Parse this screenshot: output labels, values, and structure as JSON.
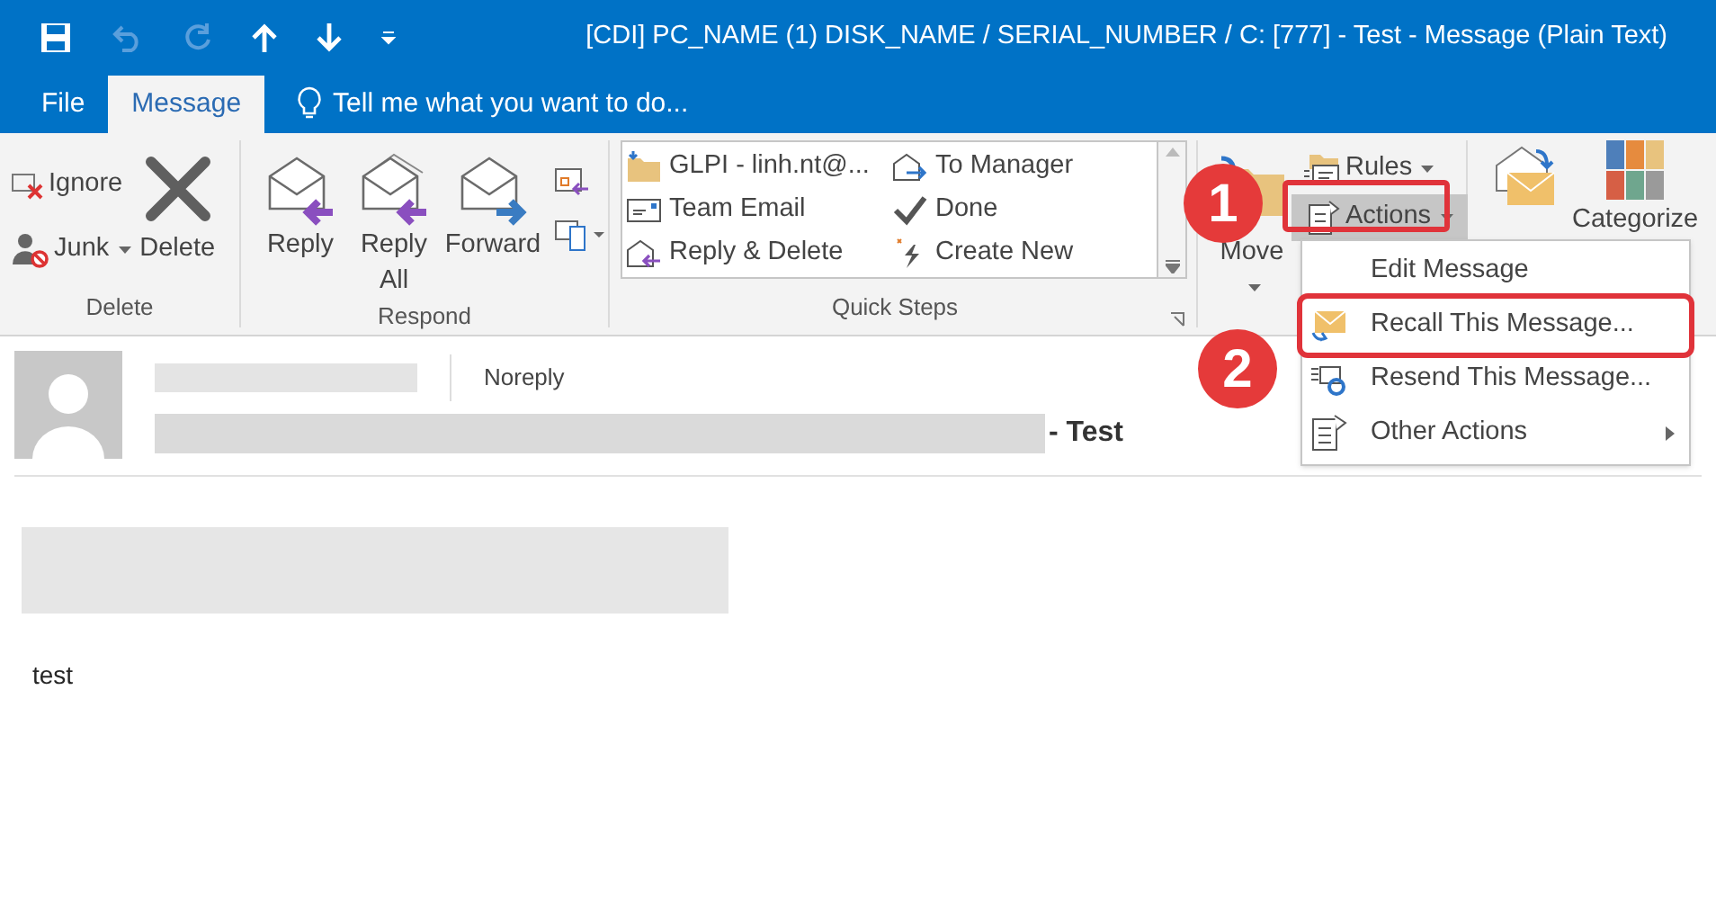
{
  "window": {
    "title": "[CDI] PC_NAME (1) DISK_NAME / SERIAL_NUMBER / C: [777] - Test - Message (Plain Text)"
  },
  "tabs": [
    {
      "label": "File",
      "selected": false
    },
    {
      "label": "Message",
      "selected": true
    }
  ],
  "tell_me": {
    "placeholder": "Tell me what you want to do..."
  },
  "delete_group": {
    "label": "Delete",
    "ignore": "Ignore",
    "junk": "Junk",
    "delete": "Delete"
  },
  "respond_group": {
    "label": "Respond",
    "reply": "Reply",
    "reply_all": [
      "Reply",
      "All"
    ],
    "forward": "Forward"
  },
  "quick_steps": {
    "label": "Quick Steps",
    "items": [
      {
        "kind": "folder",
        "label": "GLPI - linh.nt@..."
      },
      {
        "kind": "forward",
        "label": "To Manager"
      },
      {
        "kind": "email",
        "label": "Team Email"
      },
      {
        "kind": "check",
        "label": "Done"
      },
      {
        "kind": "reply",
        "label": "Reply & Delete"
      },
      {
        "kind": "new",
        "label": "Create New"
      }
    ]
  },
  "move_group": {
    "move": "Move",
    "rules": "Rules",
    "actions": {
      "label": "Actions",
      "expanded": true,
      "annotated": true
    }
  },
  "tags_group": {
    "categorize": "Categorize"
  },
  "message": {
    "from": "Noreply",
    "subject_suffix": "- Test",
    "body": "test"
  },
  "actions_menu": [
    {
      "kind": "edit",
      "label": "Edit Message",
      "annotated": false,
      "submenu": false
    },
    {
      "kind": "recall",
      "label": "Recall This Message...",
      "annotated": true,
      "submenu": false
    },
    {
      "kind": "resend",
      "label": "Resend This Message...",
      "annotated": false,
      "submenu": false
    },
    {
      "kind": "other",
      "label": "Other Actions",
      "annotated": false,
      "submenu": true
    }
  ],
  "annotations": [
    {
      "label": "1"
    },
    {
      "label": "2"
    }
  ]
}
